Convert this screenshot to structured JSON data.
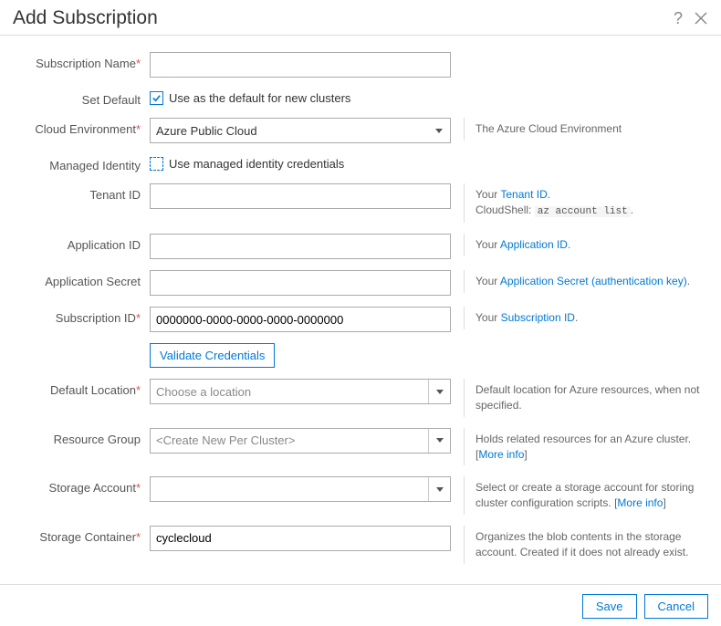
{
  "header": {
    "title": "Add Subscription"
  },
  "labels": {
    "subscriptionName": "Subscription Name",
    "setDefault": "Set Default",
    "cloudEnvironment": "Cloud Environment",
    "managedIdentity": "Managed Identity",
    "tenantId": "Tenant ID",
    "applicationId": "Application ID",
    "applicationSecret": "Application Secret",
    "subscriptionId": "Subscription ID",
    "defaultLocation": "Default Location",
    "resourceGroup": "Resource Group",
    "storageAccount": "Storage Account",
    "storageContainer": "Storage Container"
  },
  "values": {
    "subscriptionName": "",
    "setDefaultChecked": true,
    "setDefaultText": "Use as the default for new clusters",
    "cloudEnvironment": "Azure Public Cloud",
    "managedIdentityChecked": false,
    "managedIdentityText": "Use managed identity credentials",
    "tenantId": "",
    "applicationId": "",
    "applicationSecret": "",
    "subscriptionId": "0000000-0000-0000-0000-0000000",
    "validateButton": "Validate Credentials",
    "defaultLocation": "Choose a location",
    "resourceGroup": "<Create New Per Cluster>",
    "storageAccount": "",
    "storageContainer": "cyclecloud"
  },
  "desc": {
    "cloudEnvironment": "The Azure Cloud Environment",
    "tenantId_pre": "Your ",
    "tenantId_link": "Tenant ID",
    "tenantId_post": ".",
    "tenantId_line2_pre": "CloudShell: ",
    "tenantId_line2_code": "az account list",
    "tenantId_line2_post": ".",
    "applicationId_pre": "Your ",
    "applicationId_link": "Application ID",
    "applicationId_post": ".",
    "applicationSecret_pre": "Your ",
    "applicationSecret_link": "Application Secret (authentication key)",
    "applicationSecret_post": ".",
    "subscriptionId_pre": "Your ",
    "subscriptionId_link": "Subscription ID",
    "subscriptionId_post": ".",
    "defaultLocation": "Default location for Azure resources, when not specified.",
    "resourceGroup_pre": "Holds related resources for an Azure cluster. [",
    "resourceGroup_link": "More info",
    "resourceGroup_post": "]",
    "storageAccount_pre": "Select or create a storage account for storing cluster configuration scripts. [",
    "storageAccount_link": "More info",
    "storageAccount_post": "]",
    "storageContainer": "Organizes the blob contents in the storage account. Created if it does not already exist."
  },
  "footer": {
    "save": "Save",
    "cancel": "Cancel"
  }
}
